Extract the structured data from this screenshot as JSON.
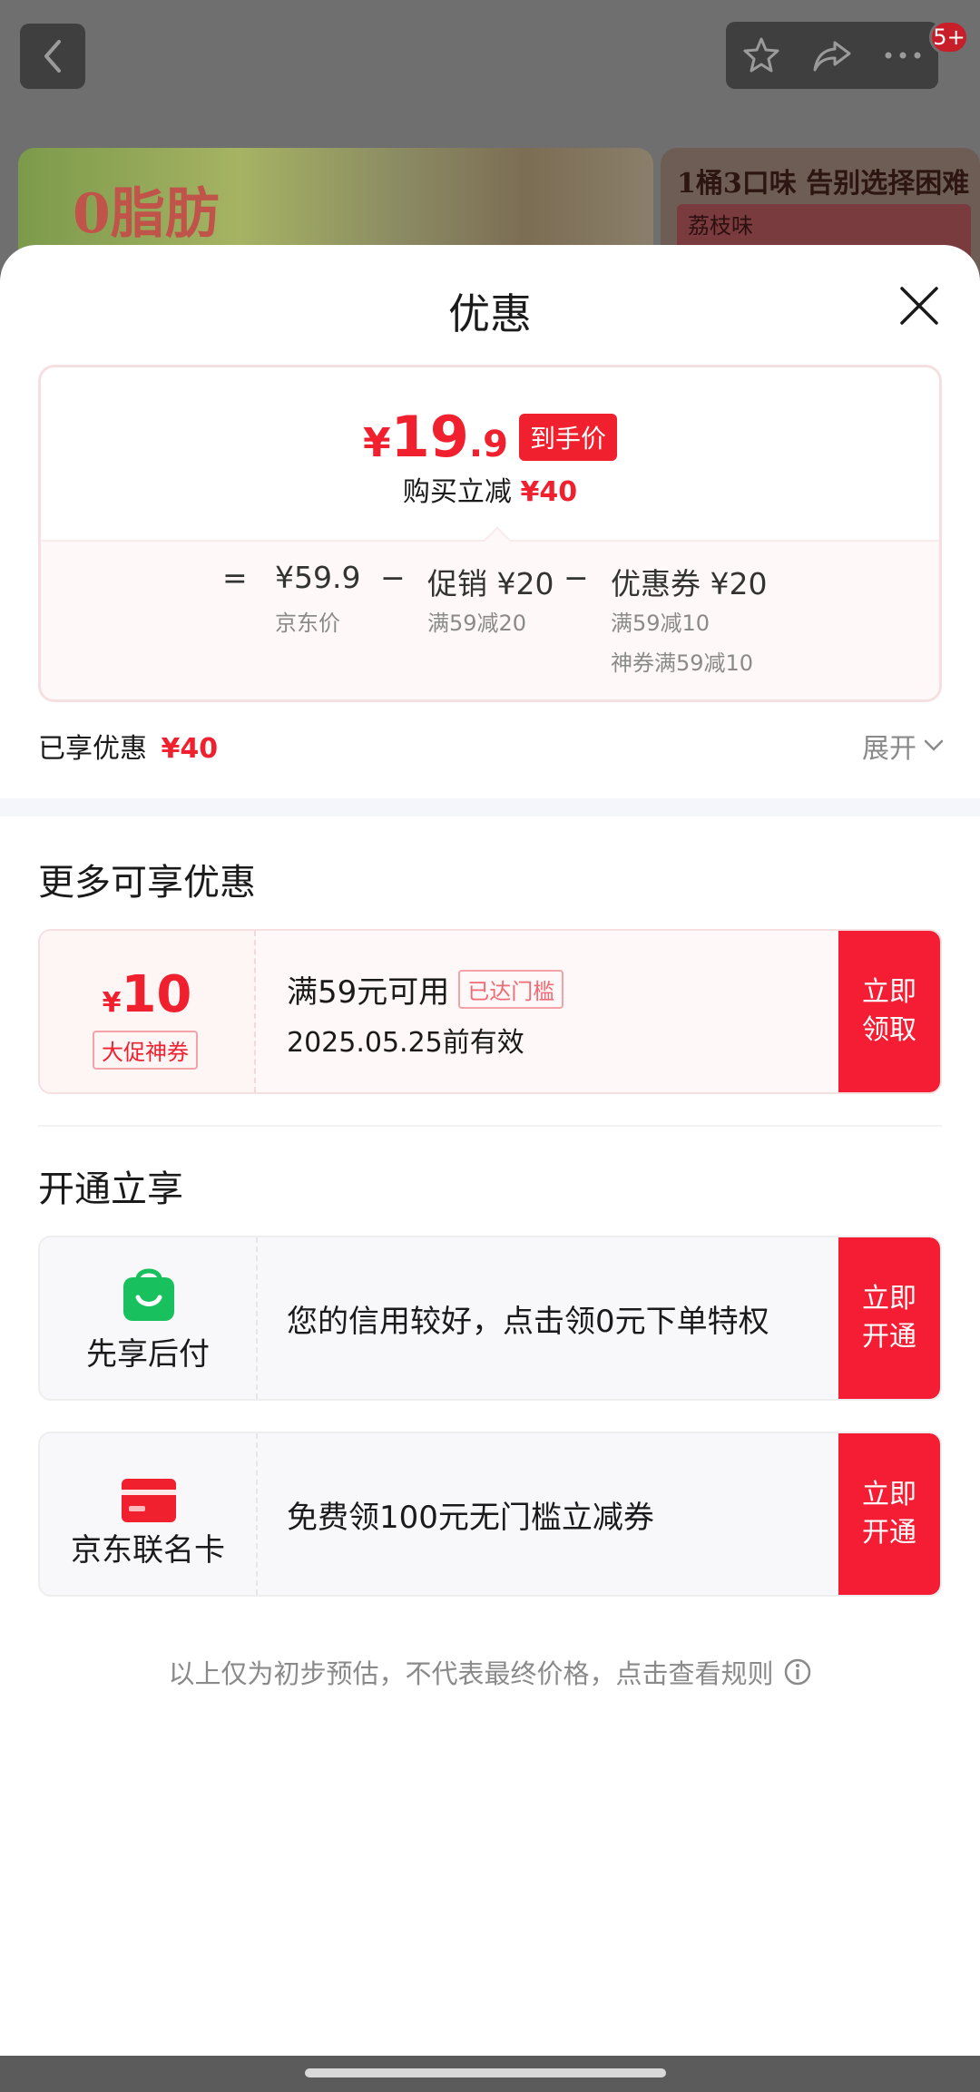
{
  "background": {
    "badge": "5+",
    "banner_left_text": "0脂肪",
    "banner_right_title": "1桶3口味 告别选择困难",
    "banner_right_sub": "荔枝味"
  },
  "sheet": {
    "title": "优惠",
    "price_card": {
      "yen": "¥",
      "price_int": "19",
      "price_dec": ".9",
      "final_tag": "到手价",
      "sub_label": "购买立减",
      "sub_value": "¥40",
      "formula": {
        "eq": "=",
        "base_value": "¥59.9",
        "base_label": "京东价",
        "minus1": "−",
        "promo_value": "促销 ¥20",
        "promo_label": "满59减20",
        "minus2": "−",
        "coupon_value": "优惠券 ¥20",
        "coupon_label1": "满59减10",
        "coupon_label2": "神券满59减10"
      }
    },
    "enjoyed": {
      "label": "已享优惠",
      "value": "¥40"
    },
    "expand_label": "展开",
    "more_section": {
      "title": "更多可享优惠",
      "coupon": {
        "yen": "¥",
        "amount": "10",
        "type": "大促神券",
        "condition": "满59元可用",
        "reach_tag": "已达门槛",
        "valid": "2025.05.25前有效",
        "button_line1": "立即",
        "button_line2": "领取"
      }
    },
    "open_section": {
      "title": "开通立享",
      "items": [
        {
          "label": "先享后付",
          "text": "您的信用较好，点击领0元下单特权",
          "button_line1": "立即",
          "button_line2": "开通",
          "icon": "shopping-bag-icon",
          "icon_color": "#19c15e"
        },
        {
          "label": "京东联名卡",
          "text": "免费领100元无门槛立减券",
          "button_line1": "立即",
          "button_line2": "开通",
          "icon": "credit-card-icon",
          "icon_color": "#f0202e"
        }
      ]
    },
    "footer_note": "以上仅为初步预估，不代表最终价格，点击查看规则"
  },
  "colors": {
    "accent_red": "#f0202e",
    "button_red": "#f51d33"
  }
}
